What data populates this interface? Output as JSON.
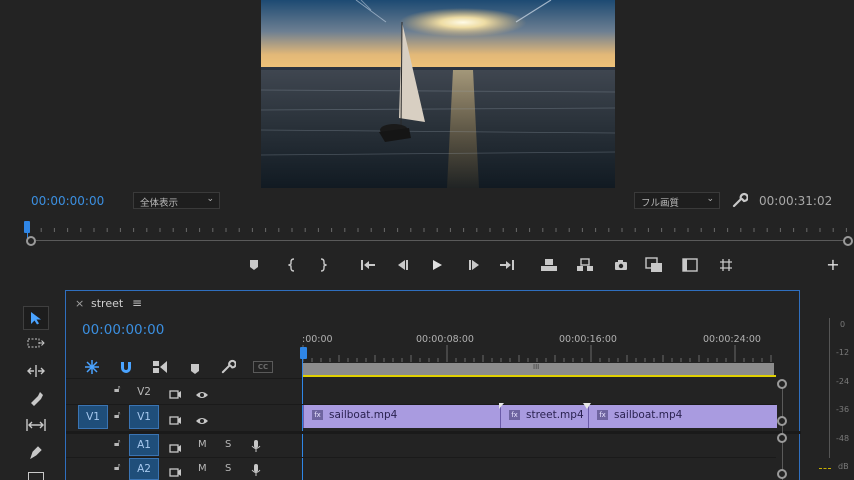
{
  "program_monitor": {
    "timecode_left": "00:00:00:00",
    "zoom_select": "全体表示",
    "quality_select": "フル画質",
    "timecode_right": "00:00:31:02"
  },
  "transport": [
    {
      "name": "add-marker-icon",
      "glyph": "⬟"
    },
    {
      "name": "mark-in-icon",
      "glyph": "{"
    },
    {
      "name": "mark-out-icon",
      "glyph": "}"
    },
    {
      "name": "go-to-in-icon",
      "glyph": "|◂"
    },
    {
      "name": "step-back-icon",
      "glyph": "◂|"
    },
    {
      "name": "play-icon",
      "glyph": "▶"
    },
    {
      "name": "step-forward-icon",
      "glyph": "|▸"
    },
    {
      "name": "go-to-out-icon",
      "glyph": "▸|"
    },
    {
      "name": "lift-icon",
      "glyph": "⏏"
    },
    {
      "name": "extract-icon",
      "glyph": "⏏"
    },
    {
      "name": "export-frame-icon",
      "glyph": "◙"
    },
    {
      "name": "comparison-view-icon",
      "glyph": "▣"
    },
    {
      "name": "filmstrip-icon",
      "glyph": "▤"
    },
    {
      "name": "safe-margins-icon",
      "glyph": "#"
    }
  ],
  "add_button": "+",
  "timeline": {
    "close": "×",
    "sequence_name": "street",
    "menu": "≡",
    "timecode": "00:00:00:00",
    "ruler_labels": [
      ":00:00",
      "00:00:08:00",
      "00:00:16:00",
      "00:00:24:00"
    ],
    "zoom_grip": "III",
    "header_icons": [
      "nest-icon",
      "snap-magnet-icon",
      "linked-selection-icon",
      "add-marker-icon",
      "wrench-icon",
      "captions-icon"
    ],
    "captions_label": "CC",
    "tracks": [
      {
        "source": "",
        "name": "V2",
        "type": "video"
      },
      {
        "source": "V1",
        "name": "V1",
        "type": "video"
      },
      {
        "source": "",
        "name": "A1",
        "type": "audio"
      },
      {
        "source": "",
        "name": "A2",
        "type": "audio"
      }
    ],
    "audio_mute": "M",
    "audio_solo": "S",
    "clips": [
      {
        "label": "sailboat.mp4"
      },
      {
        "label": "street.mp4"
      },
      {
        "label": "sailboat.mp4"
      }
    ],
    "fx_badge": "fx"
  },
  "meter": {
    "labels": [
      "0",
      "-12",
      "-24",
      "-36",
      "-48",
      "dB"
    ]
  },
  "colors": {
    "accent_blue": "#3b8fe0",
    "clip_purple": "#a99be0",
    "work_area_yellow": "#e0d000"
  }
}
